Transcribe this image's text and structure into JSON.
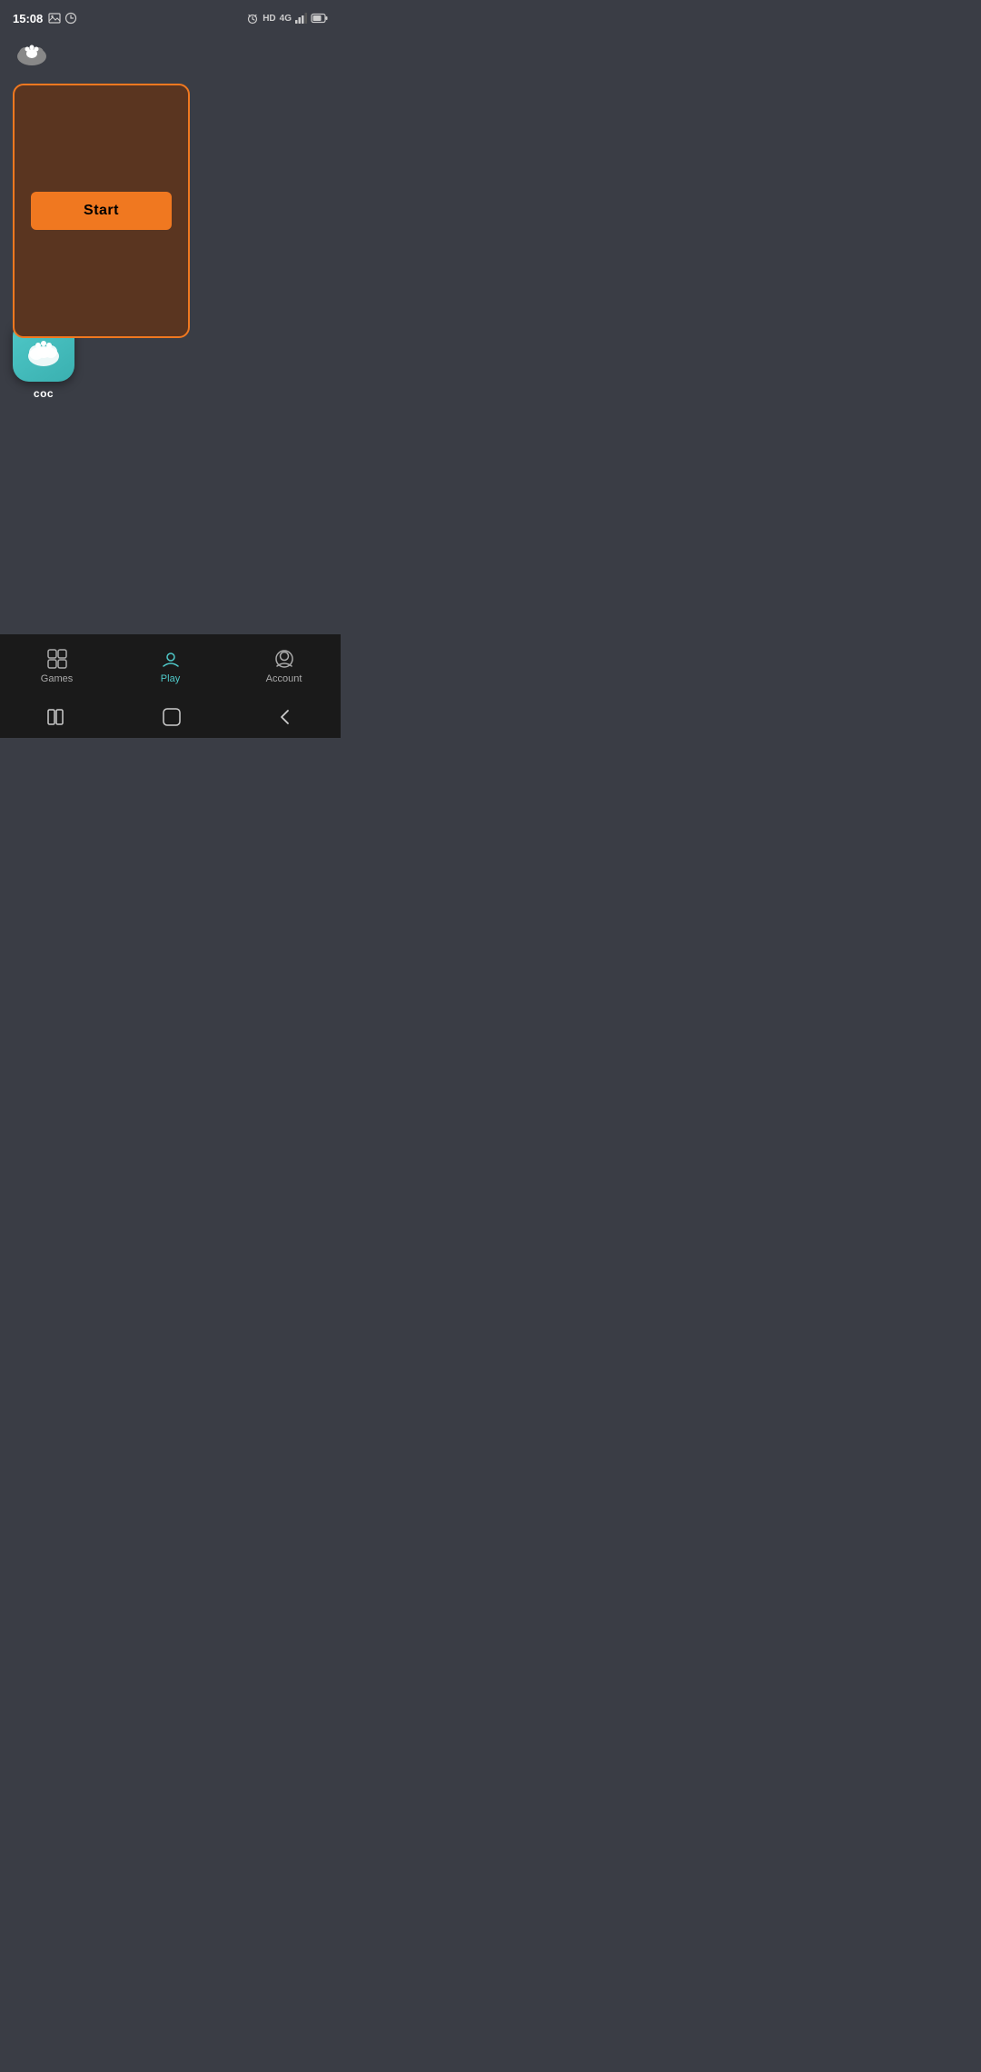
{
  "statusBar": {
    "time": "15:08",
    "leftIcons": [
      "image-icon",
      "history-icon"
    ],
    "rightIcons": [
      "alarm-icon",
      "hd-badge",
      "4g-icon",
      "signal-icon",
      "battery-icon"
    ]
  },
  "header": {
    "appIcon": "paw-cloud-icon"
  },
  "gameCard": {
    "startButtonLabel": "Start"
  },
  "appIconSection": {
    "iconColor": "#4fc8c8",
    "label": "coc"
  },
  "bottomNav": {
    "items": [
      {
        "id": "games",
        "label": "Games",
        "active": false
      },
      {
        "id": "play",
        "label": "Play",
        "active": true
      },
      {
        "id": "account",
        "label": "Account",
        "active": false
      }
    ]
  },
  "colors": {
    "accent": "#f07820",
    "teal": "#4fc8c8",
    "cardBg": "#5a3520",
    "pageBg": "#3a3d45",
    "navBg": "#1a1a1a"
  }
}
